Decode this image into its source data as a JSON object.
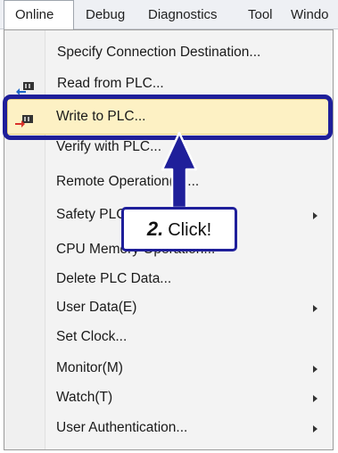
{
  "menubar": {
    "items": [
      {
        "label": "Online"
      },
      {
        "label": "Debug"
      },
      {
        "label": "Diagnostics"
      },
      {
        "label": "Tool"
      },
      {
        "label": "Windo"
      }
    ]
  },
  "menu": {
    "items": [
      {
        "label": "Specify Connection Destination..."
      },
      {
        "label": "Read from PLC...",
        "icon": "read-from-plc-icon"
      },
      {
        "label": "Write to PLC...",
        "icon": "write-to-plc-icon",
        "highlighted": true
      },
      {
        "label": "Verify with PLC..."
      },
      {
        "label": "Remote Operation(S)..."
      },
      {
        "label": "Safety PLC",
        "submenu": true
      },
      {
        "label": "CPU Memory Operation..."
      },
      {
        "label": "Delete PLC Data..."
      },
      {
        "label": "User Data(E)",
        "submenu": true
      },
      {
        "label": "Set Clock..."
      },
      {
        "label": "Monitor(M)",
        "submenu": true
      },
      {
        "label": "Watch(T)",
        "submenu": true
      },
      {
        "label": "User Authentication...",
        "submenu": true
      }
    ]
  },
  "callout": {
    "step": "2.",
    "text": "Click!"
  },
  "colors": {
    "callout": "#1f1f9a",
    "highlight": "#fdf1c4"
  }
}
